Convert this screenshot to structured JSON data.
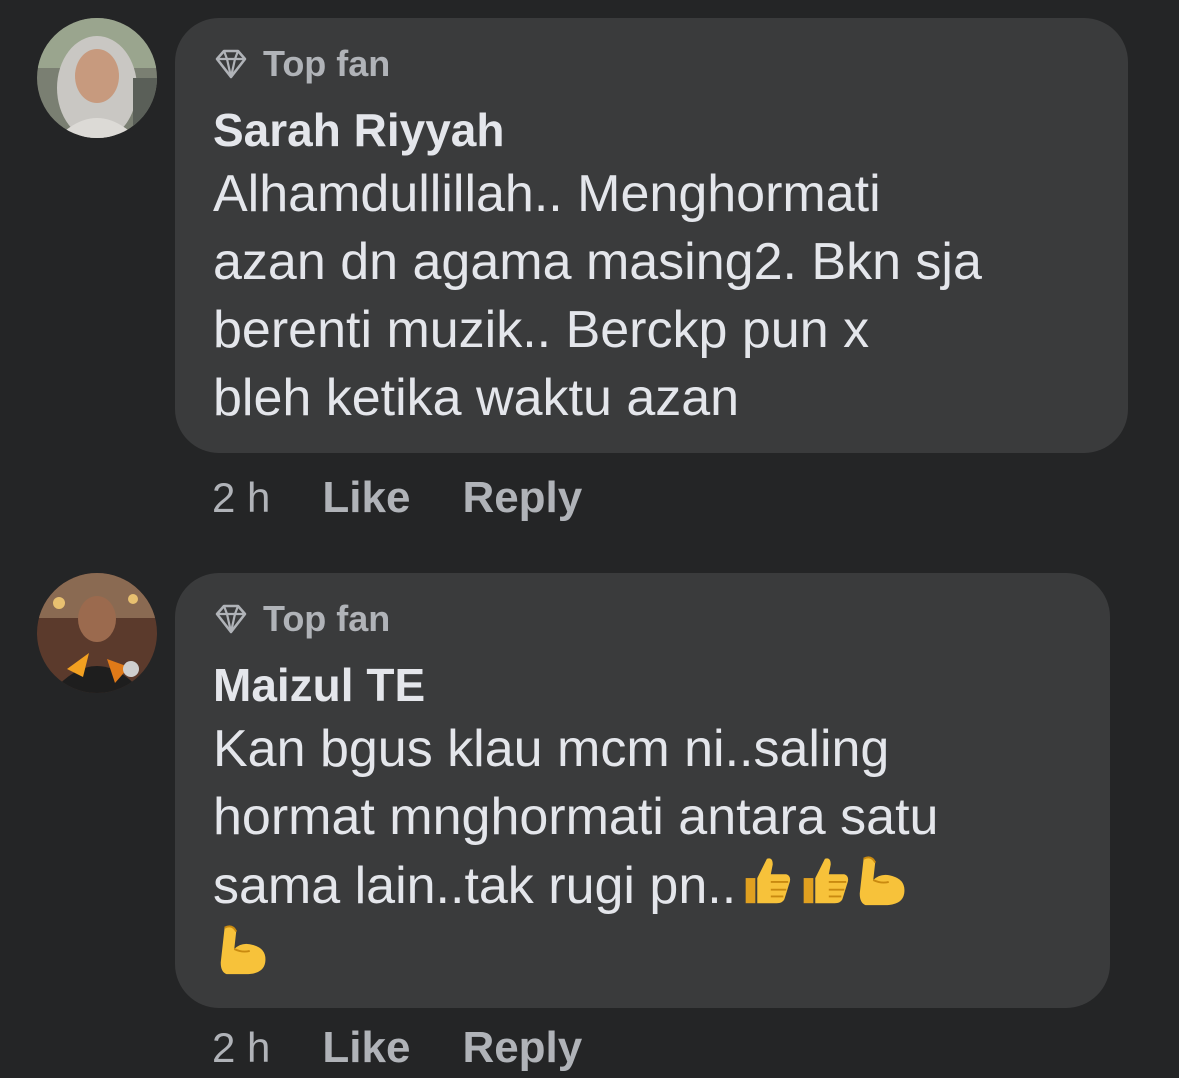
{
  "comments": [
    {
      "badge": "Top fan",
      "author": "Sarah Riyyah",
      "text": "Alhamdullillah.. Menghormati\nazan dn agama masing2. Bkn sja\nberenti muzik.. Berckp pun x\nbleh ketika waktu azan",
      "time": "2 h",
      "like_label": "Like",
      "reply_label": "Reply"
    },
    {
      "badge": "Top fan",
      "author": "Maizul TE",
      "text_line1": "Kan bgus klau mcm ni..saling",
      "text_line2": "hormat mnghormati antara satu",
      "text_line3": "sama lain..tak rugi pn..",
      "emojis": [
        "thumbs-up",
        "thumbs-up",
        "flexed-biceps",
        "flexed-biceps"
      ],
      "time": "2 h",
      "like_label": "Like",
      "reply_label": "Reply"
    }
  ],
  "colors": {
    "background": "#242526",
    "bubble": "#3a3b3c",
    "primary_text": "#e4e6eb",
    "secondary_text": "#b0b3b8"
  }
}
